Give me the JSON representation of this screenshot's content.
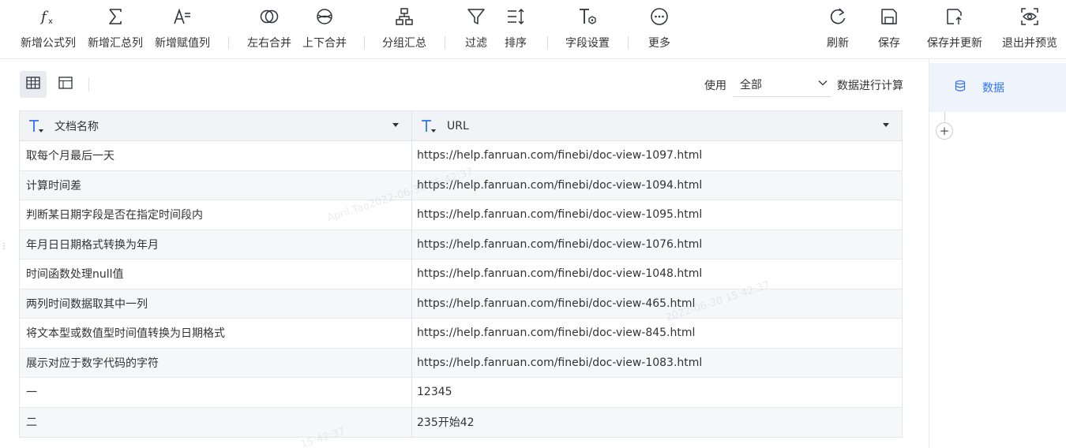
{
  "toolbar": {
    "items": [
      {
        "label": "新增公式列",
        "icon": "formula-fx-icon"
      },
      {
        "label": "新增汇总列",
        "icon": "sigma-icon"
      },
      {
        "label": "新增赋值列",
        "icon": "assign-value-icon"
      },
      {
        "label": "左右合并",
        "icon": "horizontal-merge-icon"
      },
      {
        "label": "上下合并",
        "icon": "vertical-merge-icon"
      },
      {
        "label": "分组汇总",
        "icon": "group-summary-icon"
      },
      {
        "label": "过滤",
        "icon": "filter-funnel-icon"
      },
      {
        "label": "排序",
        "icon": "sort-icon"
      },
      {
        "label": "字段设置",
        "icon": "field-settings-icon"
      },
      {
        "label": "更多",
        "icon": "more-dots-icon"
      },
      {
        "label": "刷新",
        "icon": "refresh-icon"
      },
      {
        "label": "保存",
        "icon": "save-icon"
      },
      {
        "label": "保存并更新",
        "icon": "save-update-icon"
      },
      {
        "label": "退出并预览",
        "icon": "exit-preview-icon"
      }
    ]
  },
  "subbar": {
    "view_icons": [
      "table-grid-icon",
      "layout-panel-icon"
    ],
    "use_label": "使用",
    "use_select_value": "全部",
    "calc_label": "数据进行计算"
  },
  "table": {
    "columns": [
      {
        "name": "文档名称",
        "type_icon": "text-type-icon"
      },
      {
        "name": "URL",
        "type_icon": "text-type-icon"
      }
    ],
    "rows": [
      [
        "取每个月最后一天",
        "https://help.fanruan.com/finebi/doc-view-1097.html"
      ],
      [
        "计算时间差",
        "https://help.fanruan.com/finebi/doc-view-1094.html"
      ],
      [
        "判断某日期字段是否在指定时间段内",
        "https://help.fanruan.com/finebi/doc-view-1095.html"
      ],
      [
        "年月日日期格式转换为年月",
        "https://help.fanruan.com/finebi/doc-view-1076.html"
      ],
      [
        "时间函数处理null值",
        "https://help.fanruan.com/finebi/doc-view-1048.html"
      ],
      [
        "两列时间数据取其中一列",
        "https://help.fanruan.com/finebi/doc-view-465.html"
      ],
      [
        "将文本型或数值型时间值转换为日期格式",
        "https://help.fanruan.com/finebi/doc-view-845.html"
      ],
      [
        "展示对应于数字代码的字符",
        "https://help.fanruan.com/finebi/doc-view-1083.html"
      ],
      [
        "一",
        "12345"
      ],
      [
        "二",
        "235开始42"
      ]
    ]
  },
  "watermark": {
    "lines": [
      "April.Tao2022-06-30 15:42:37",
      "2022-06-30 15:42:37",
      "15:42:37"
    ]
  },
  "right_panel": {
    "step_label": "数据",
    "step_icon": "database-icon",
    "add_icon": "plus-icon"
  },
  "colors": {
    "accent": "#3173f0",
    "icon": "#2d3239",
    "header_bg": "#f1f3f7"
  }
}
